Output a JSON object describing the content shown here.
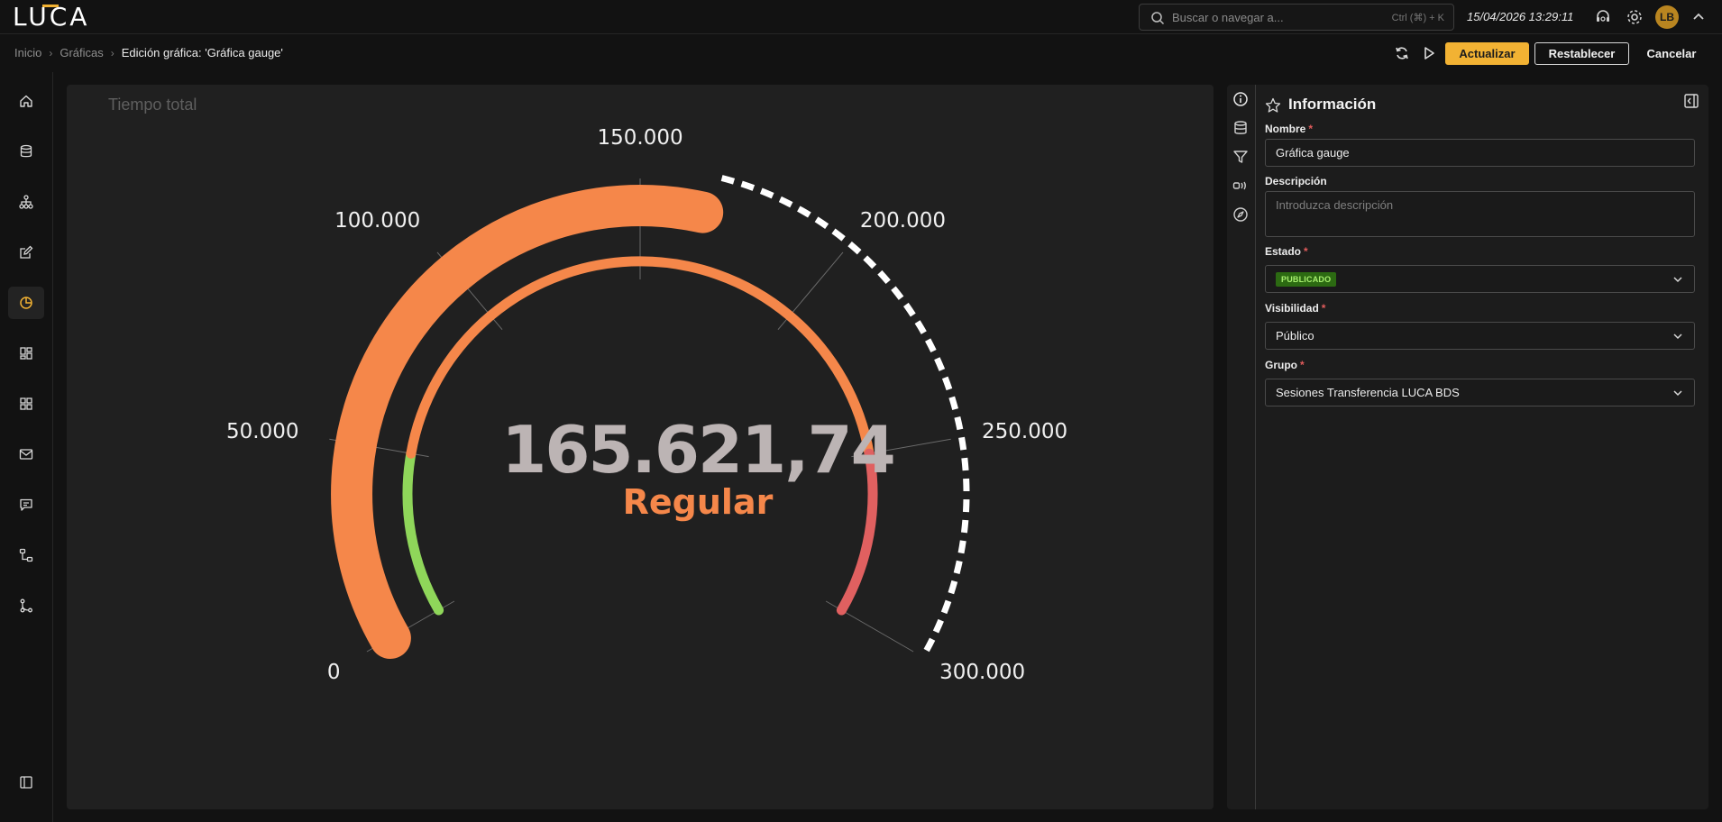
{
  "app": {
    "logo": "LUCA",
    "search_placeholder": "Buscar o navegar a...",
    "search_shortcut": "Ctrl (⌘) + K",
    "datetime": "15/04/2026 13:29:11",
    "avatar_initials": "LB",
    "accent_color": "#f2b233"
  },
  "breadcrumb": {
    "items": [
      "Inicio",
      "Gráficas"
    ],
    "current": "Edición gráfica: 'Gráfica gauge'"
  },
  "actions": {
    "update": "Actualizar",
    "reset": "Restablecer",
    "cancel": "Cancelar"
  },
  "nav": {
    "items": [
      "home-icon",
      "database-icon",
      "hierarchy-icon",
      "edit-icon",
      "chart-icon",
      "dashboard-icon",
      "grid-icon",
      "mail-icon",
      "message-icon",
      "flow-icon",
      "branch-icon"
    ],
    "active": "chart-icon",
    "footer_icon": "sidebar-toggle-icon"
  },
  "chart": {
    "title": "Tiempo total",
    "value_text": "165.621,74",
    "status_text": "Regular"
  },
  "chart_data": {
    "type": "gauge",
    "title": "Tiempo total",
    "min": 0,
    "max": 300000,
    "value": 165621.74,
    "value_label": "165.621,74",
    "status": "Regular",
    "ticks": [
      {
        "value": 0,
        "label": "0"
      },
      {
        "value": 50000,
        "label": "50.000"
      },
      {
        "value": 100000,
        "label": "100.000"
      },
      {
        "value": 150000,
        "label": "150.000"
      },
      {
        "value": 200000,
        "label": "200.000"
      },
      {
        "value": 250000,
        "label": "250.000"
      },
      {
        "value": 300000,
        "label": "300.000"
      }
    ],
    "bands": [
      {
        "from": 0,
        "to": 50000,
        "color": "#8fd65a"
      },
      {
        "from": 50000,
        "to": 250000,
        "color": "#f5874a"
      },
      {
        "from": 250000,
        "to": 300000,
        "color": "#e06060"
      }
    ],
    "value_color": "#f5874a",
    "remaining_style": "dashed",
    "remaining_color": "#ffffff"
  },
  "panel": {
    "title": "Información",
    "tabs": [
      "info-icon",
      "database-icon",
      "filter-icon",
      "variables-icon",
      "compass-icon"
    ],
    "fields": {
      "name_label": "Nombre",
      "name_value": "Gráfica gauge",
      "description_label": "Descripción",
      "description_placeholder": "Introduzca descripción",
      "status_label": "Estado",
      "status_value": "PUBLICADO",
      "visibility_label": "Visibilidad",
      "visibility_value": "Público",
      "group_label": "Grupo",
      "group_value": "Sesiones Transferencia LUCA BDS"
    }
  }
}
